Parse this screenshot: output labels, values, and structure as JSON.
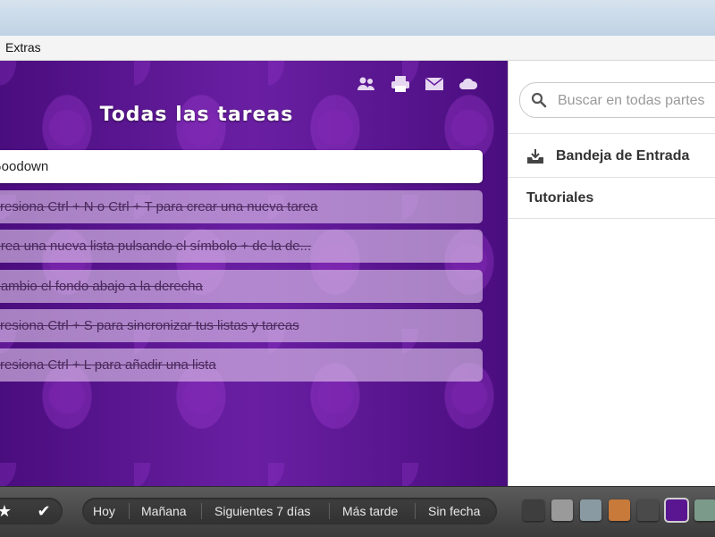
{
  "menubar": {
    "extras": "Extras"
  },
  "list_title": "Todas las tareas",
  "tasks": [
    {
      "text": "Goodown",
      "done": false
    },
    {
      "text": "Presiona Ctrl + N o Ctrl + T para crear una nueva tarea",
      "done": true
    },
    {
      "text": "Crea una nueva lista pulsando el símbolo + de la de...",
      "done": true
    },
    {
      "text": "Cambio el fondo abajo a la derecha",
      "done": true
    },
    {
      "text": "Presiona Ctrl + S para sincronizar tus listas y tareas",
      "done": true
    },
    {
      "text": "Presiona Ctrl + L para añadir una lista",
      "done": true
    }
  ],
  "top_icons": [
    "share-icon",
    "print-icon",
    "mail-icon",
    "cloud-icon"
  ],
  "sidebar": {
    "search_placeholder": "Buscar en todas partes",
    "items": [
      {
        "label": "Bandeja de Entrada",
        "icon": "inbox-icon"
      },
      {
        "label": "Tutoriales"
      }
    ]
  },
  "bottom": {
    "filters": [
      "Hoy",
      "Mañana",
      "Siguientes 7 días",
      "Más tarde",
      "Sin fecha"
    ],
    "icons": [
      "star-icon",
      "checkmark-icon"
    ],
    "swatches": [
      "#3e3e3e",
      "#9a9a9a",
      "#8a9aa3",
      "#c77a3a",
      "#4a4a4a",
      "#5a1591",
      "#7c9a8a"
    ],
    "selected_swatch": 5
  }
}
